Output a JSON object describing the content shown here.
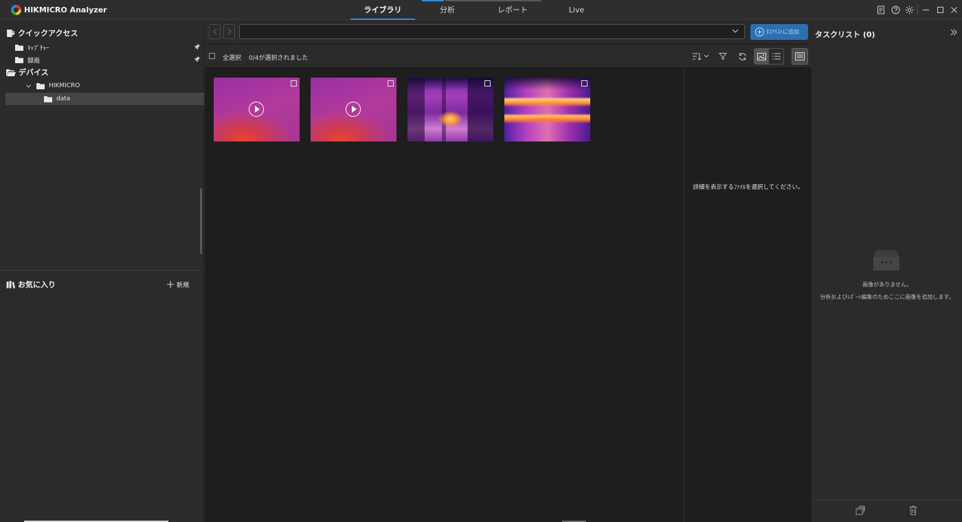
{
  "app": {
    "title": "HIKMICRO Analyzer"
  },
  "main_tabs": [
    {
      "label": "ライブラリ",
      "active": true
    },
    {
      "label": "分析",
      "active": false
    },
    {
      "label": "レポート",
      "active": false
    },
    {
      "label": "Live",
      "active": false
    }
  ],
  "window_controls": [
    "notes-icon",
    "help-icon",
    "settings-icon",
    "minimize-icon",
    "maximize-icon",
    "close-icon"
  ],
  "sidebar": {
    "quick_access": {
      "label": "クイックアクセス",
      "items": [
        {
          "label": "ｷｬﾌﾟﾁｬｰ",
          "pinned": true
        },
        {
          "label": "録画",
          "pinned": true
        }
      ]
    },
    "devices": {
      "label": "デバイス",
      "device": {
        "label": "HIKMICRO",
        "expanded": true
      },
      "folder": {
        "label": "data",
        "selected": true
      }
    },
    "favorites": {
      "label": "お気に入り",
      "new_label": "新規"
    }
  },
  "library": {
    "path_value": "",
    "add_to_task_label": "ﾀｽｸﾘｽﾄに追加",
    "select_all_label": "全選択",
    "selection_status": "0/4が選択されました",
    "thumbnails": [
      {
        "kind": "video",
        "selected": false
      },
      {
        "kind": "video",
        "selected": false
      },
      {
        "kind": "thermal-image",
        "selected": false
      },
      {
        "kind": "thermal-image",
        "selected": false
      }
    ],
    "detail_placeholder": "詳細を表示するﾌｧｲﾙを選択してください。"
  },
  "task_list": {
    "title": "タスクリスト",
    "count": "(0)",
    "empty_title": "画像がありません。",
    "empty_hint": "分析およびﾚﾎﾟｰﾄ編集のためここに画像を追加します。"
  },
  "colors": {
    "accent": "#2f8de4",
    "button_blue": "#2c6fb3",
    "panel_bg": "#2b2b2b",
    "content_bg": "#1e1e1e"
  }
}
